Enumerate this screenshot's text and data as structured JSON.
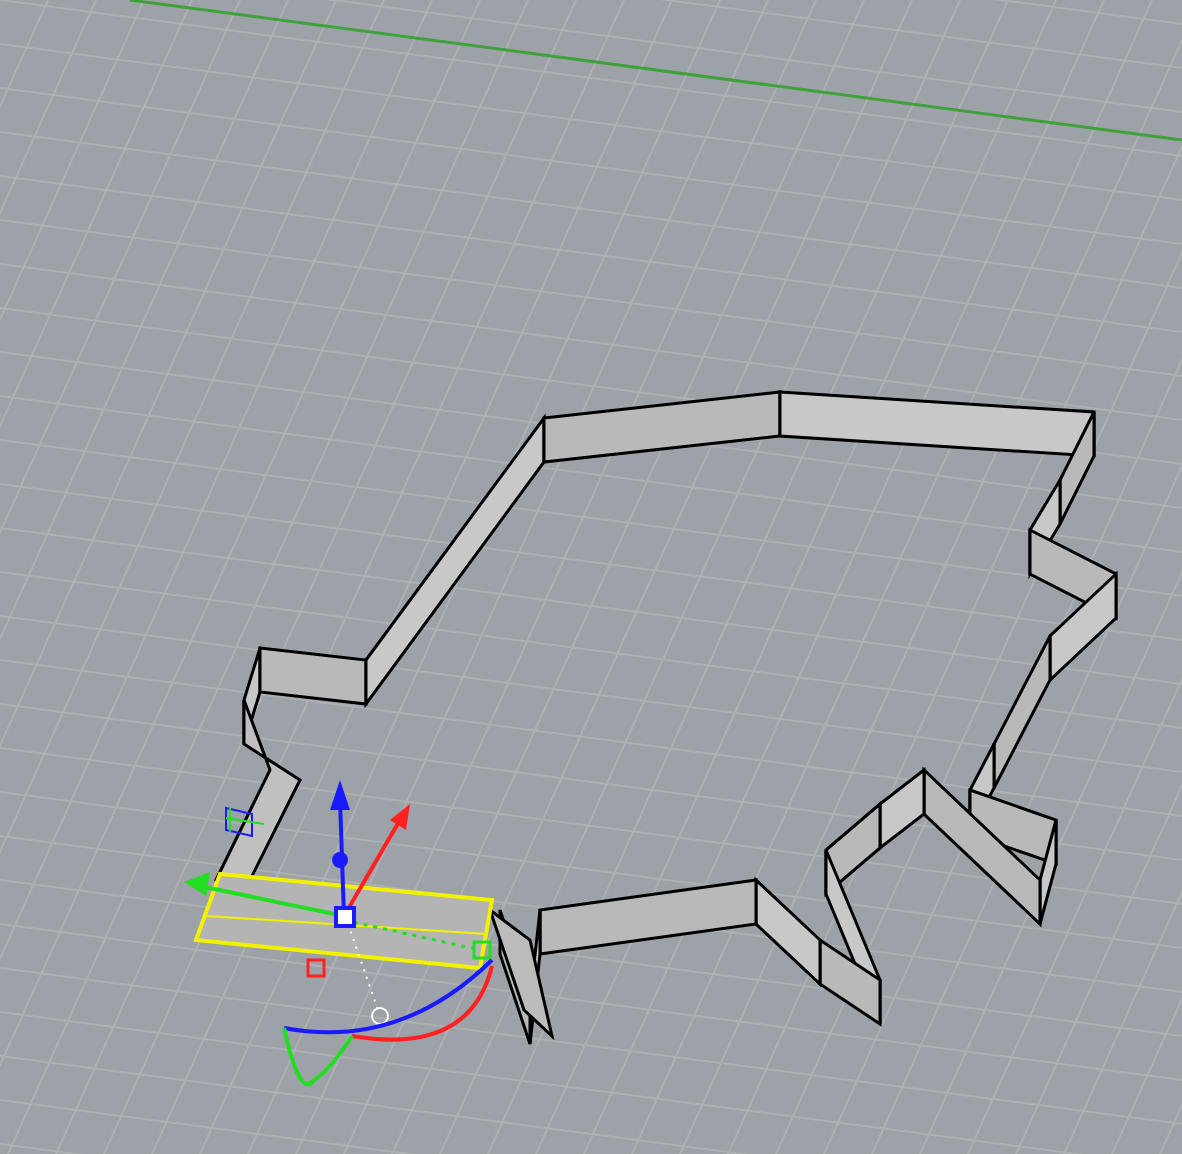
{
  "viewport": {
    "grid": true,
    "world_axis": true,
    "gumball": true,
    "selected_segment": true
  }
}
